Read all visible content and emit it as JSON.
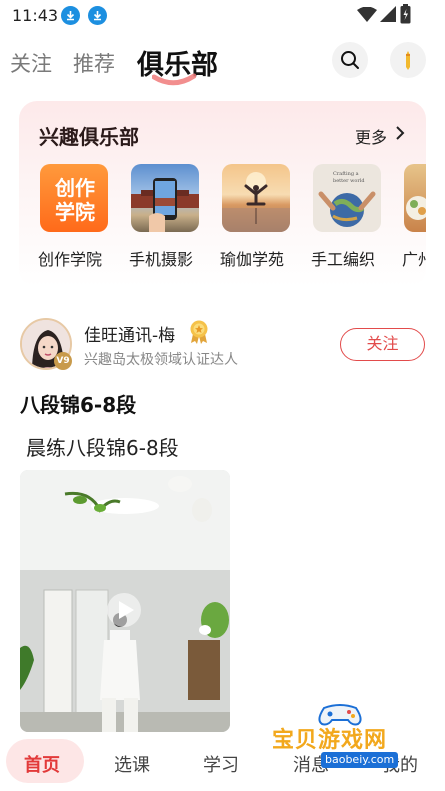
{
  "status_bar": {
    "time": "11:43"
  },
  "top_nav": {
    "tabs": [
      {
        "label": "关注"
      },
      {
        "label": "推荐"
      },
      {
        "label": "俱乐部"
      }
    ],
    "active_tab": "俱乐部"
  },
  "club": {
    "title": "兴趣俱乐部",
    "more_label": "更多",
    "items": [
      {
        "label": "创作学院",
        "thumb_text": "创作\n学院"
      },
      {
        "label": "手机摄影"
      },
      {
        "label": "瑜伽学苑"
      },
      {
        "label": "手工编织",
        "thumb_text": "Crafting a better world"
      },
      {
        "label": "广州"
      }
    ]
  },
  "post": {
    "author_name": "佳旺通讯-梅",
    "author_level": "V9",
    "author_desc": "兴趣岛太极领域认证达人",
    "follow_label": "关注",
    "title": "八段锦6-8段",
    "text": "晨练八段锦6-8段"
  },
  "bottom_nav": {
    "items": [
      {
        "label": "首页"
      },
      {
        "label": "选课"
      },
      {
        "label": "学习"
      },
      {
        "label": "消息"
      },
      {
        "label": "我的"
      }
    ],
    "active": "首页"
  },
  "watermark": {
    "text": "宝贝游戏网",
    "url": "baobeiy.com"
  },
  "colors": {
    "accent": "#e23a3a",
    "card_bg": "#fde9ea",
    "download_icon": "#1c8fe0"
  }
}
